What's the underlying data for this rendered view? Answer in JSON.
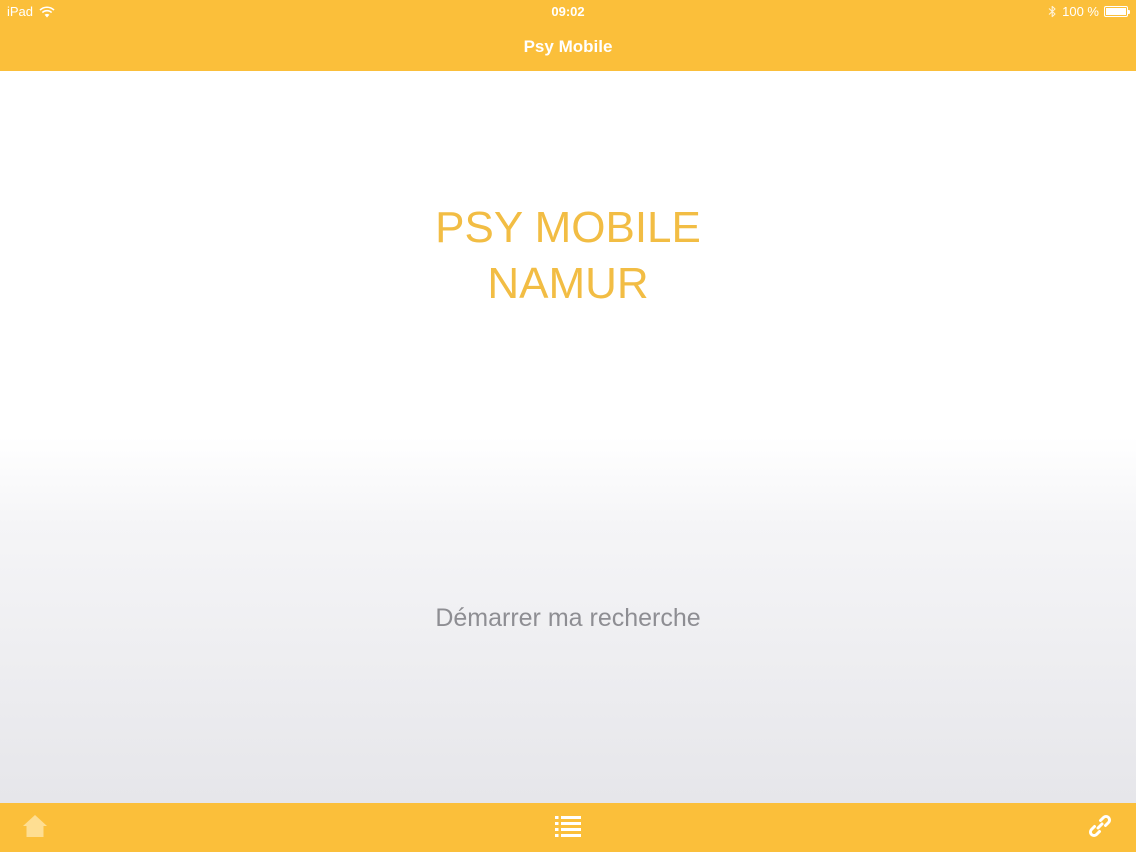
{
  "status_bar": {
    "device": "iPad",
    "time": "09:02",
    "battery": "100 %",
    "battery_level": 1.0
  },
  "nav": {
    "title": "Psy Mobile"
  },
  "main": {
    "title_lines": [
      "PSY MOBILE",
      "NAMUR"
    ],
    "start_label": "Démarrer ma recherche"
  },
  "tabbar": {
    "items": [
      {
        "icon": "home-icon"
      },
      {
        "icon": "list-icon"
      },
      {
        "icon": "link-icon"
      }
    ]
  },
  "colors": {
    "accent": "#fbbf3a",
    "title_text": "#f2bd44",
    "secondary_text": "#8e8e93"
  }
}
